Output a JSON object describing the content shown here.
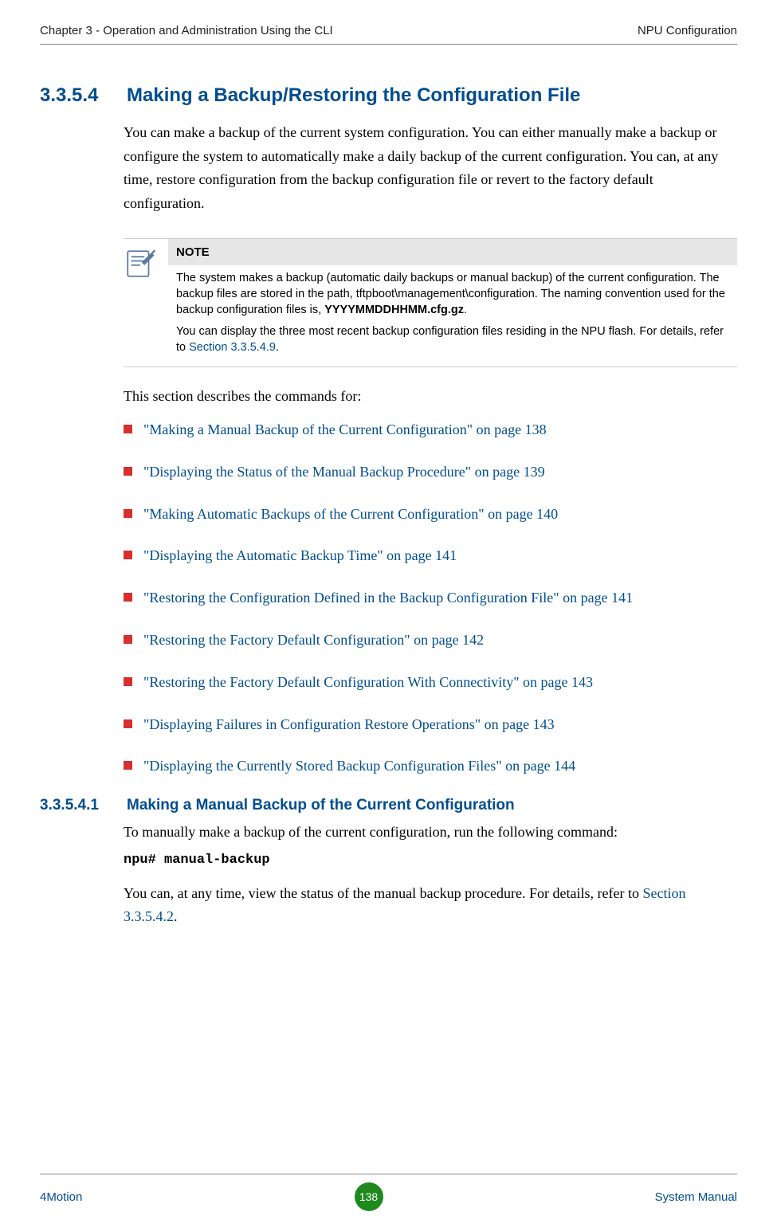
{
  "header": {
    "left": "Chapter 3 - Operation and Administration Using the CLI",
    "right": "NPU Configuration"
  },
  "section": {
    "number": "3.3.5.4",
    "title": "Making a Backup/Restoring the Configuration File",
    "intro": "You can make a backup of the current system configuration. You can either manually make a backup or configure the system to automatically make a daily backup of the current configuration. You can, at any time, restore configuration from the backup configuration file or revert to the factory default configuration."
  },
  "note": {
    "label": "NOTE",
    "p1_part1": "The system makes a backup (automatic daily backups or manual backup) of the current configuration. The backup files are stored in the path, tftpboot\\management\\configuration. The naming convention used for the backup configuration files is, ",
    "p1_bold": "YYYYMMDDHHMM.cfg.gz",
    "p1_part2": ".",
    "p2_part1": "You can display the three most recent backup configuration files residing in the NPU flash. For details, refer to ",
    "p2_link": "Section 3.3.5.4.9",
    "p2_part2": "."
  },
  "list_intro": "This section describes the commands for:",
  "list": [
    "\"Making a Manual Backup of the Current Configuration\" on page 138",
    "\"Displaying the Status of the Manual Backup Procedure\" on page 139",
    "\"Making Automatic Backups of the Current Configuration\" on page 140",
    "\"Displaying the Automatic Backup Time\" on page 141",
    "\"Restoring the Configuration Defined in the Backup Configuration File\" on page 141",
    "\"Restoring the Factory Default Configuration\" on page 142",
    "\"Restoring the Factory Default Configuration With Connectivity\" on page 143",
    "\"Displaying Failures in Configuration Restore Operations\" on page 143",
    "\"Displaying the Currently Stored Backup Configuration Files\" on page 144"
  ],
  "sub_section": {
    "number": "3.3.5.4.1",
    "title": "Making a Manual Backup of the Current Configuration",
    "body": "To manually make a backup of the current configuration, run the following command:",
    "cmd": "npu# manual-backup",
    "tail_part1": "You can, at any time, view the status of the manual backup procedure. For details, refer to ",
    "tail_link": "Section 3.3.5.4.2",
    "tail_part2": "."
  },
  "footer": {
    "left": "4Motion",
    "page": "138",
    "right": "System Manual"
  }
}
